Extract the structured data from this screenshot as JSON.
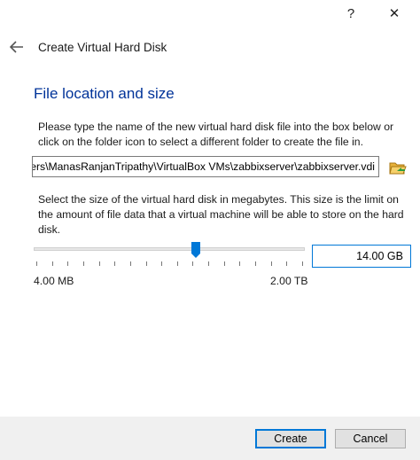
{
  "window": {
    "help_label": "?",
    "close_label": "✕"
  },
  "header": {
    "title": "Create Virtual Hard Disk",
    "back_icon": "back-arrow-icon"
  },
  "main": {
    "section_title": "File location and size",
    "location_description": "Please type the name of the new virtual hard disk file into the box below or click on the folder icon to select a different folder to create the file in.",
    "file_path": "C:\\Users\\ManasRanjanTripathy\\VirtualBox VMs\\zabbixserver\\zabbixserver.vdi",
    "folder_icon": "folder-open-icon",
    "size_description": "Select the size of the virtual hard disk in megabytes. This size is the limit on the amount of file data that a virtual machine will be able to store on the hard disk.",
    "size_value": "14.00 GB",
    "slider_position_fraction": 0.6,
    "min_label": "4.00 MB",
    "max_label": "2.00 TB"
  },
  "footer": {
    "create_label": "Create",
    "cancel_label": "Cancel"
  },
  "colors": {
    "accent": "#0078d7",
    "title_blue": "#003399"
  }
}
